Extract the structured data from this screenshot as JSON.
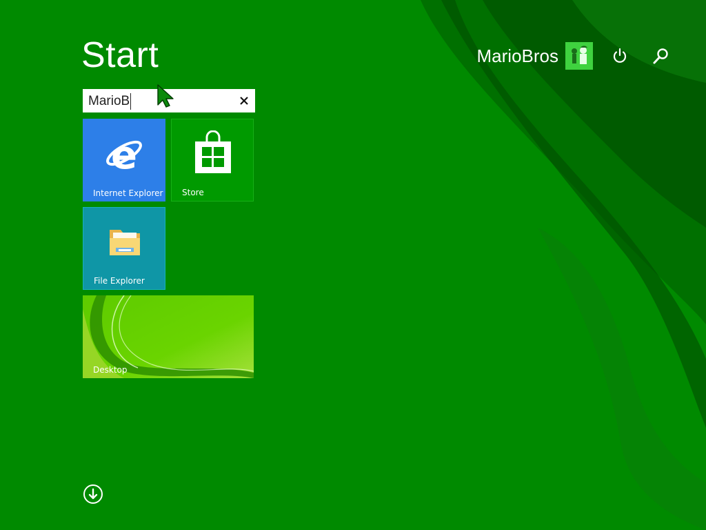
{
  "start": {
    "title": "Start"
  },
  "user": {
    "name": "MarioBros"
  },
  "icons": {
    "power": "power-icon",
    "search": "magnifier-icon",
    "clear": "close-x-icon",
    "all_apps": "down-arrow-circle-icon"
  },
  "search": {
    "value": "MarioB"
  },
  "tiles": [
    {
      "label": "Internet Explorer",
      "icon": "internet-explorer-icon",
      "color": "#2d7fe8"
    },
    {
      "label": "Store",
      "icon": "store-bag-icon",
      "color": "#009a00"
    },
    {
      "label": "File Explorer",
      "icon": "folder-icon",
      "color": "#0f96a6"
    },
    {
      "label": "Desktop",
      "icon": "desktop-wallpaper",
      "color": "#6ad400"
    }
  ],
  "colors": {
    "background": "#008a00",
    "accent": "#3fd23f"
  }
}
